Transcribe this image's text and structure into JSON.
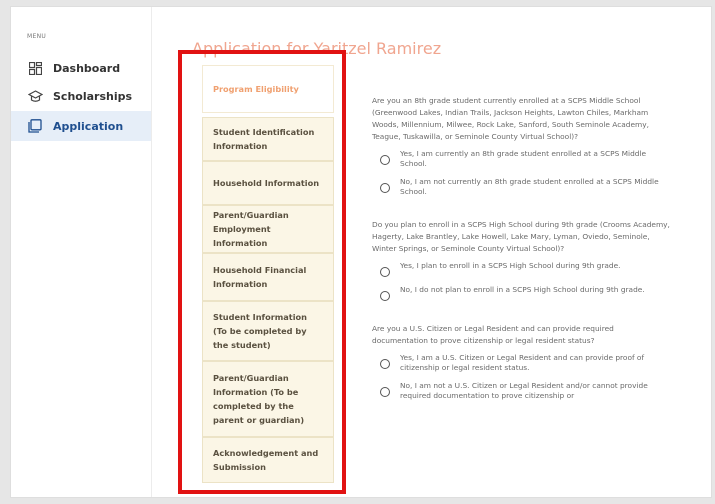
{
  "sidebar": {
    "menu_label": "MENU",
    "items": [
      {
        "label": "Dashboard",
        "icon": "dashboard-icon"
      },
      {
        "label": "Scholarships",
        "icon": "graduation-cap-icon"
      },
      {
        "label": "Application",
        "icon": "application-icon",
        "active": true
      }
    ]
  },
  "main": {
    "title": "Application for Yaritzel Ramirez",
    "steps": [
      "Program Eligibility",
      "Student Identification Information",
      "Household Information",
      "Parent/Guardian Employment Information",
      "Household Financial Information",
      "Student Information (To be completed by the student)",
      "Parent/Guardian Information (To be completed by the parent or guardian)",
      "Acknowledgement and Submission"
    ],
    "questions": [
      {
        "text": "Are you an 8th grade student currently enrolled at a SCPS Middle School (Greenwood Lakes, Indian Trails, Jackson Heights, Lawton Chiles, Markham Woods, Millennium, Milwee, Rock Lake, Sanford, South Seminole Academy, Teague, Tuskawilla, or Seminole County Virtual School)?",
        "options": [
          "Yes, I am currently an 8th grade student enrolled at a SCPS Middle School.",
          "No, I am not currently an 8th grade student enrolled at a SCPS Middle School."
        ]
      },
      {
        "text": "Do you plan to enroll in a SCPS High School during 9th grade (Crooms Academy, Hagerty, Lake Brantley, Lake Howell, Lake Mary, Lyman, Oviedo, Seminole, Winter Springs, or Seminole County Virtual School)?",
        "options": [
          "Yes, I plan to enroll in a SCPS High School during 9th grade.",
          "No, I do not plan to enroll in a SCPS High School during 9th grade."
        ]
      },
      {
        "text": "Are you a U.S. Citizen or Legal Resident and can provide required documentation to prove citizenship or legal resident status?",
        "options": [
          "Yes, I am a U.S. Citizen or Legal Resident and can provide proof of citizenship or legal resident status.",
          "No, I am not a U.S. Citizen or Legal Resident and/or cannot provide required documentation to prove citizenship or"
        ]
      }
    ]
  },
  "colors": {
    "highlight": "#e11212",
    "title": "#f0a58f",
    "active_nav": "#1f4f8f",
    "step_bg": "#fbf6e6"
  }
}
